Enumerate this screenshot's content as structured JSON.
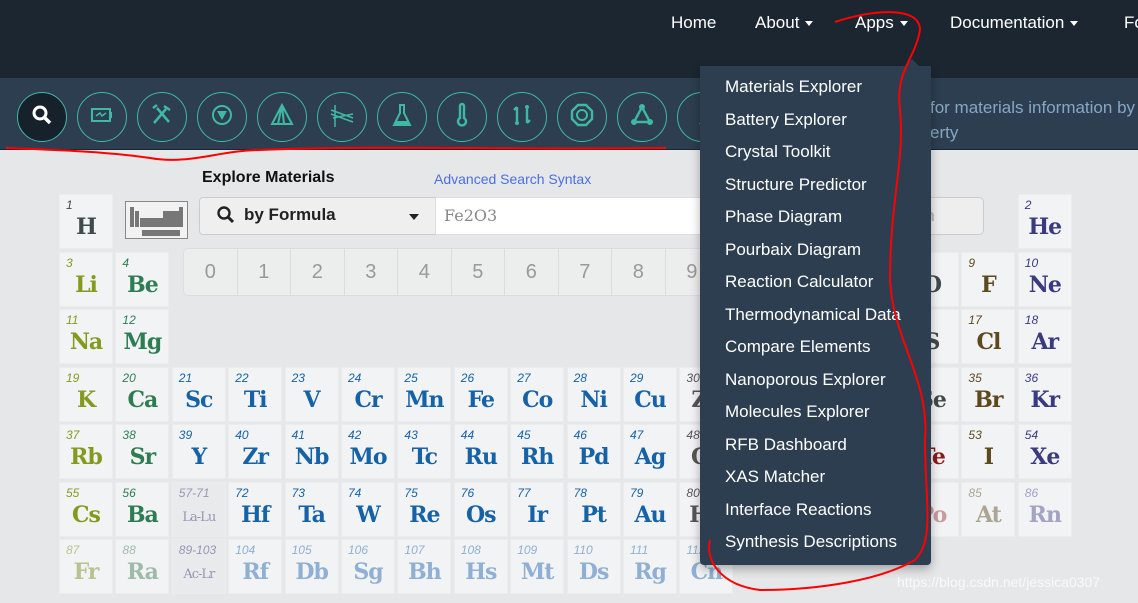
{
  "nav": {
    "items": [
      {
        "label": "Home",
        "caret": false
      },
      {
        "label": "About",
        "caret": true
      },
      {
        "label": "Apps",
        "caret": true
      },
      {
        "label": "Documentation",
        "caret": true
      },
      {
        "label": "Fo",
        "caret": false
      }
    ]
  },
  "toolbar": {
    "tools": [
      "search-icon",
      "battery-icon",
      "tools-icon",
      "structure-predictor-icon",
      "phase-diagram-icon",
      "pourbaix-icon",
      "flask-icon",
      "thermometer-icon",
      "compare-icon",
      "nanoporous-icon",
      "molecule-icon",
      "more-icon"
    ],
    "tagline_line1": "for materials information by",
    "tagline_line2": "erty",
    "accent": "#3fb8a4"
  },
  "explore": {
    "title": "Explore Materials",
    "advanced_link": "Advanced Search Syntax",
    "search_mode": "by Formula",
    "query": "Fe2O3",
    "search_button": "arch"
  },
  "keypad": [
    "0",
    "1",
    "2",
    "3",
    "4",
    "5",
    "6",
    "7",
    "8",
    "9"
  ],
  "apps_menu": [
    "Materials Explorer",
    "Battery Explorer",
    "Crystal Toolkit",
    "Structure Predictor",
    "Phase Diagram",
    "Pourbaix Diagram",
    "Reaction Calculator",
    "Thermodynamical Data",
    "Compare Elements",
    "Nanoporous Explorer",
    "Molecules Explorer",
    "RFB Dashboard",
    "XAS Matcher",
    "Interface Reactions",
    "Synthesis Descriptions"
  ],
  "elements": [
    {
      "n": "1",
      "s": "H",
      "r": 0,
      "c": 0,
      "color": "#3f4a4a"
    },
    {
      "n": "2",
      "s": "He",
      "r": 0,
      "c": 17,
      "color": "#3a3a80"
    },
    {
      "n": "3",
      "s": "Li",
      "r": 1,
      "c": 0,
      "color": "#849a1f"
    },
    {
      "n": "4",
      "s": "Be",
      "r": 1,
      "c": 1,
      "color": "#2e7d52"
    },
    {
      "n": "8",
      "s": "O",
      "r": 1,
      "c": 15,
      "color": "#3f4a4a"
    },
    {
      "n": "9",
      "s": "F",
      "r": 1,
      "c": 16,
      "color": "#5c4a1e"
    },
    {
      "n": "10",
      "s": "Ne",
      "r": 1,
      "c": 17,
      "color": "#3a3a80"
    },
    {
      "n": "11",
      "s": "Na",
      "r": 2,
      "c": 0,
      "color": "#849a1f"
    },
    {
      "n": "12",
      "s": "Mg",
      "r": 2,
      "c": 1,
      "color": "#2e7d52"
    },
    {
      "n": "16",
      "s": "S",
      "r": 2,
      "c": 15,
      "color": "#3f4a4a"
    },
    {
      "n": "17",
      "s": "Cl",
      "r": 2,
      "c": 16,
      "color": "#5c4a1e"
    },
    {
      "n": "18",
      "s": "Ar",
      "r": 2,
      "c": 17,
      "color": "#3a3a80"
    },
    {
      "n": "19",
      "s": "K",
      "r": 3,
      "c": 0,
      "color": "#849a1f"
    },
    {
      "n": "20",
      "s": "Ca",
      "r": 3,
      "c": 1,
      "color": "#2e7d52"
    },
    {
      "n": "21",
      "s": "Sc",
      "r": 3,
      "c": 2,
      "color": "#1562a6"
    },
    {
      "n": "22",
      "s": "Ti",
      "r": 3,
      "c": 3,
      "color": "#1562a6"
    },
    {
      "n": "23",
      "s": "V",
      "r": 3,
      "c": 4,
      "color": "#1562a6"
    },
    {
      "n": "24",
      "s": "Cr",
      "r": 3,
      "c": 5,
      "color": "#1562a6"
    },
    {
      "n": "25",
      "s": "Mn",
      "r": 3,
      "c": 6,
      "color": "#1562a6"
    },
    {
      "n": "26",
      "s": "Fe",
      "r": 3,
      "c": 7,
      "color": "#1562a6"
    },
    {
      "n": "27",
      "s": "Co",
      "r": 3,
      "c": 8,
      "color": "#1562a6"
    },
    {
      "n": "28",
      "s": "Ni",
      "r": 3,
      "c": 9,
      "color": "#1562a6"
    },
    {
      "n": "29",
      "s": "Cu",
      "r": 3,
      "c": 10,
      "color": "#1562a6"
    },
    {
      "n": "30",
      "s": "Zn",
      "r": 3,
      "c": 11,
      "color": "#555"
    },
    {
      "n": "34",
      "s": "Se",
      "r": 3,
      "c": 15,
      "color": "#3f4a4a"
    },
    {
      "n": "35",
      "s": "Br",
      "r": 3,
      "c": 16,
      "color": "#5c4a1e"
    },
    {
      "n": "36",
      "s": "Kr",
      "r": 3,
      "c": 17,
      "color": "#3a3a80"
    },
    {
      "n": "37",
      "s": "Rb",
      "r": 4,
      "c": 0,
      "color": "#849a1f"
    },
    {
      "n": "38",
      "s": "Sr",
      "r": 4,
      "c": 1,
      "color": "#2e7d52"
    },
    {
      "n": "39",
      "s": "Y",
      "r": 4,
      "c": 2,
      "color": "#1562a6"
    },
    {
      "n": "40",
      "s": "Zr",
      "r": 4,
      "c": 3,
      "color": "#1562a6"
    },
    {
      "n": "41",
      "s": "Nb",
      "r": 4,
      "c": 4,
      "color": "#1562a6"
    },
    {
      "n": "42",
      "s": "Mo",
      "r": 4,
      "c": 5,
      "color": "#1562a6"
    },
    {
      "n": "43",
      "s": "Tc",
      "r": 4,
      "c": 6,
      "color": "#1562a6"
    },
    {
      "n": "44",
      "s": "Ru",
      "r": 4,
      "c": 7,
      "color": "#1562a6"
    },
    {
      "n": "45",
      "s": "Rh",
      "r": 4,
      "c": 8,
      "color": "#1562a6"
    },
    {
      "n": "46",
      "s": "Pd",
      "r": 4,
      "c": 9,
      "color": "#1562a6"
    },
    {
      "n": "47",
      "s": "Ag",
      "r": 4,
      "c": 10,
      "color": "#1562a6"
    },
    {
      "n": "48",
      "s": "Cd",
      "r": 4,
      "c": 11,
      "color": "#555"
    },
    {
      "n": "52",
      "s": "Te",
      "r": 4,
      "c": 15,
      "color": "#8b1a1a"
    },
    {
      "n": "53",
      "s": "I",
      "r": 4,
      "c": 16,
      "color": "#5c4a1e"
    },
    {
      "n": "54",
      "s": "Xe",
      "r": 4,
      "c": 17,
      "color": "#3a3a80"
    },
    {
      "n": "55",
      "s": "Cs",
      "r": 5,
      "c": 0,
      "color": "#849a1f"
    },
    {
      "n": "56",
      "s": "Ba",
      "r": 5,
      "c": 1,
      "color": "#2e7d52"
    },
    {
      "n": "57-71",
      "s": "La-Lu",
      "r": 5,
      "c": 2,
      "color": "#9a94b8",
      "ph": true
    },
    {
      "n": "72",
      "s": "Hf",
      "r": 5,
      "c": 3,
      "color": "#1562a6"
    },
    {
      "n": "73",
      "s": "Ta",
      "r": 5,
      "c": 4,
      "color": "#1562a6"
    },
    {
      "n": "74",
      "s": "W",
      "r": 5,
      "c": 5,
      "color": "#1562a6"
    },
    {
      "n": "75",
      "s": "Re",
      "r": 5,
      "c": 6,
      "color": "#1562a6"
    },
    {
      "n": "76",
      "s": "Os",
      "r": 5,
      "c": 7,
      "color": "#1562a6"
    },
    {
      "n": "77",
      "s": "Ir",
      "r": 5,
      "c": 8,
      "color": "#1562a6"
    },
    {
      "n": "78",
      "s": "Pt",
      "r": 5,
      "c": 9,
      "color": "#1562a6"
    },
    {
      "n": "79",
      "s": "Au",
      "r": 5,
      "c": 10,
      "color": "#1562a6"
    },
    {
      "n": "80",
      "s": "Hg",
      "r": 5,
      "c": 11,
      "color": "#555"
    },
    {
      "n": "84",
      "s": "Po",
      "r": 5,
      "c": 15,
      "color": "#c99a9a"
    },
    {
      "n": "85",
      "s": "At",
      "r": 5,
      "c": 16,
      "color": "#aca592"
    },
    {
      "n": "86",
      "s": "Rn",
      "r": 5,
      "c": 17,
      "color": "#a3a3c4"
    },
    {
      "n": "87",
      "s": "Fr",
      "r": 6,
      "c": 0,
      "color": "#b9c28f"
    },
    {
      "n": "88",
      "s": "Ra",
      "r": 6,
      "c": 1,
      "color": "#9dbba9"
    },
    {
      "n": "89-103",
      "s": "Ac-Lr",
      "r": 6,
      "c": 2,
      "color": "#9a94b8",
      "ph": true
    },
    {
      "n": "104",
      "s": "Rf",
      "r": 6,
      "c": 3,
      "color": "#8fb0d3"
    },
    {
      "n": "105",
      "s": "Db",
      "r": 6,
      "c": 4,
      "color": "#8fb0d3"
    },
    {
      "n": "106",
      "s": "Sg",
      "r": 6,
      "c": 5,
      "color": "#8fb0d3"
    },
    {
      "n": "107",
      "s": "Bh",
      "r": 6,
      "c": 6,
      "color": "#8fb0d3"
    },
    {
      "n": "108",
      "s": "Hs",
      "r": 6,
      "c": 7,
      "color": "#8fb0d3"
    },
    {
      "n": "109",
      "s": "Mt",
      "r": 6,
      "c": 8,
      "color": "#8fb0d3"
    },
    {
      "n": "110",
      "s": "Ds",
      "r": 6,
      "c": 9,
      "color": "#8fb0d3"
    },
    {
      "n": "111",
      "s": "Rg",
      "r": 6,
      "c": 10,
      "color": "#8fb0d3"
    },
    {
      "n": "112",
      "s": "Cn",
      "r": 6,
      "c": 11,
      "color": "#8fb0d3"
    }
  ],
  "watermark": "https://blog.csdn.net/jessica0307"
}
